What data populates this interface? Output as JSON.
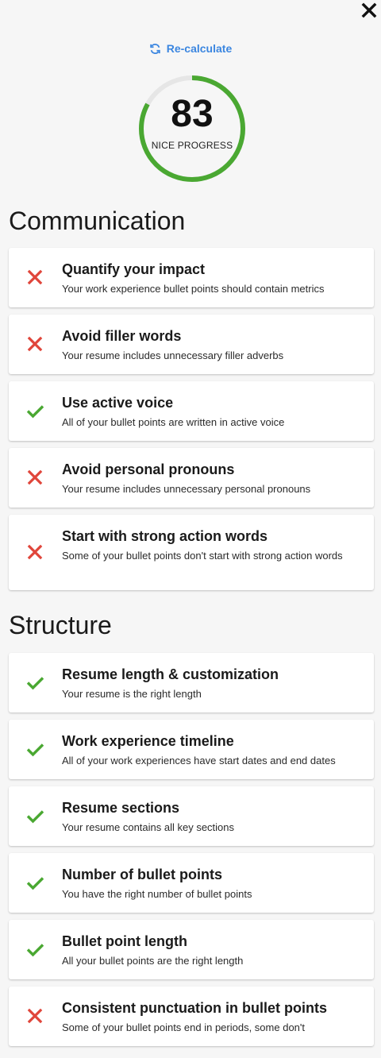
{
  "header": {
    "recalculate_label": "Re-calculate"
  },
  "score": {
    "value": "83",
    "label": "NICE PROGRESS",
    "progress": 0.83,
    "color": "#4aa832"
  },
  "sections": [
    {
      "title": "Communication",
      "items": [
        {
          "title": "Quantify your impact",
          "description": "Your work experience bullet points should contain metrics",
          "status": "fail"
        },
        {
          "title": "Avoid filler words",
          "description": "Your resume includes unnecessary filler adverbs",
          "status": "fail"
        },
        {
          "title": "Use active voice",
          "description": "All of your bullet points are written in active voice",
          "status": "pass"
        },
        {
          "title": "Avoid personal pronouns",
          "description": "Your resume includes unnecessary personal pronouns",
          "status": "fail"
        },
        {
          "title": "Start with strong action words",
          "description": "Some of your bullet points don't start with strong action words",
          "status": "fail"
        }
      ]
    },
    {
      "title": "Structure",
      "items": [
        {
          "title": "Resume length & customization",
          "description": "Your resume is the right length",
          "status": "pass"
        },
        {
          "title": "Work experience timeline",
          "description": "All of your work experiences have start dates and end dates",
          "status": "pass"
        },
        {
          "title": "Resume sections",
          "description": "Your resume contains all key sections",
          "status": "pass"
        },
        {
          "title": "Number of bullet points",
          "description": "You have the right number of bullet points",
          "status": "pass"
        },
        {
          "title": "Bullet point length",
          "description": "All your bullet points are the right length",
          "status": "pass"
        },
        {
          "title": "Consistent punctuation in bullet points",
          "description": "Some of your bullet points end in periods, some don't",
          "status": "fail"
        }
      ]
    }
  ],
  "colors": {
    "pass": "#4aa832",
    "fail": "#e0453a",
    "link": "#3b86e0"
  }
}
